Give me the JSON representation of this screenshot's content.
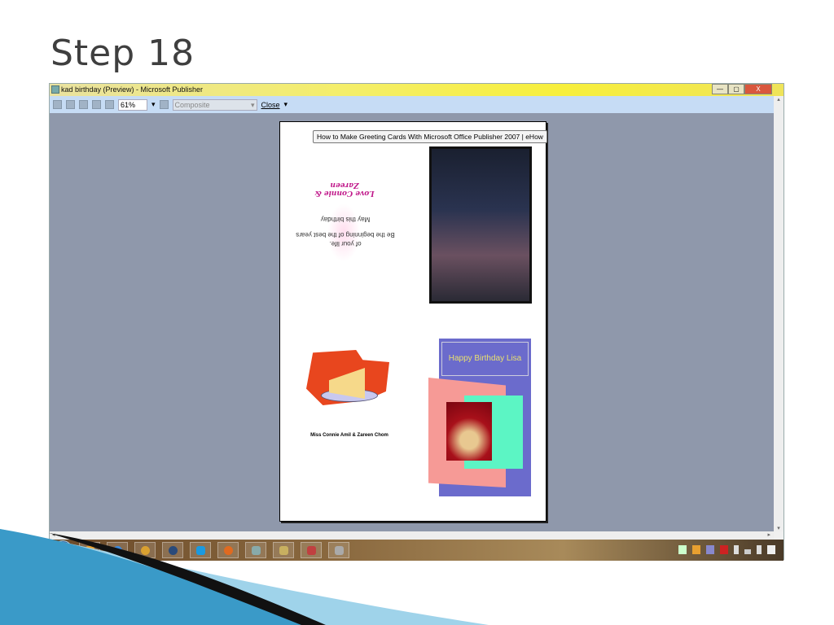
{
  "slide": {
    "title": "Step 18"
  },
  "window": {
    "title": "kad birthday (Preview)  - Microsoft Publisher",
    "minimize": "—",
    "restore": "▢",
    "close": "X"
  },
  "toolbar": {
    "zoom": "61%",
    "zoom_arrow": "▾",
    "mode": "Composite",
    "mode_arrow": "▾",
    "close_label": "Close",
    "overflow": "▾"
  },
  "scroll": {
    "up": "▴",
    "down": "▾",
    "left": "◂",
    "right": "▸"
  },
  "page": {
    "tooltip": "How to Make Greeting Cards With Microsoft Office Publisher 2007 | eHow",
    "signoff": "Love Connie & Zareen",
    "verse": [
      "May this birthday",
      "Be the beginning of the best years",
      "of your life."
    ],
    "names": "Miss Connie Amil & Zareen Chom",
    "cover_title": "Happy Birthday Lisa"
  },
  "taskbar": {
    "apps": [
      "media-player",
      "internet-explorer",
      "chrome",
      "itunes",
      "skype",
      "firefox",
      "publisher-preview",
      "file-explorer",
      "office",
      "misc"
    ]
  },
  "colors": {
    "titlebar": "#f4ee6a",
    "workspace": "#8f98ab",
    "cover": "#6b6bcc",
    "signoff": "#c0188a"
  }
}
